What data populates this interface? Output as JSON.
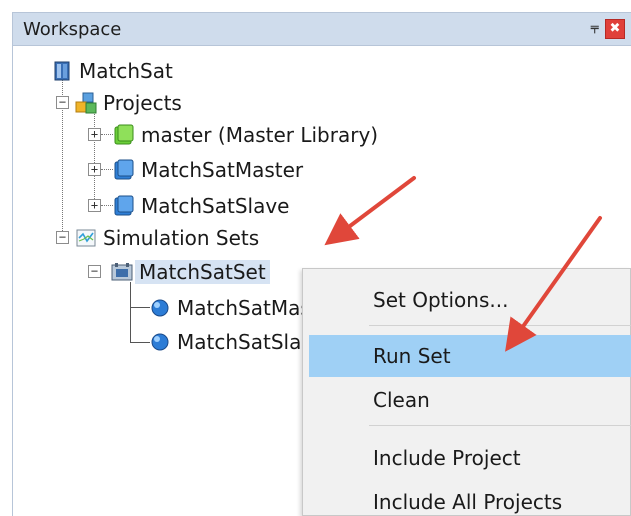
{
  "workspace": {
    "title": "Workspace",
    "pin_glyph": "⫧",
    "close_glyph": "✖"
  },
  "tree": {
    "root": "MatchSat",
    "projects": {
      "label": "Projects",
      "children": [
        "master (Master Library)",
        "MatchSatMaster",
        "MatchSatSlave"
      ]
    },
    "simulation_sets": {
      "label": "Simulation Sets",
      "set": {
        "label": "MatchSatSet",
        "children": [
          "MatchSatMaster",
          "MatchSatSlave"
        ]
      }
    },
    "expander_minus": "−",
    "expander_plus": "+"
  },
  "context_menu": {
    "items": [
      "Set Options...",
      "Run Set",
      "Clean",
      "Include Project",
      "Include All Projects"
    ],
    "hover_index": 1
  },
  "colors": {
    "arrow": "#e0473a",
    "menu_hover": "#9fd0f5",
    "selection": "#d6e3f3"
  }
}
